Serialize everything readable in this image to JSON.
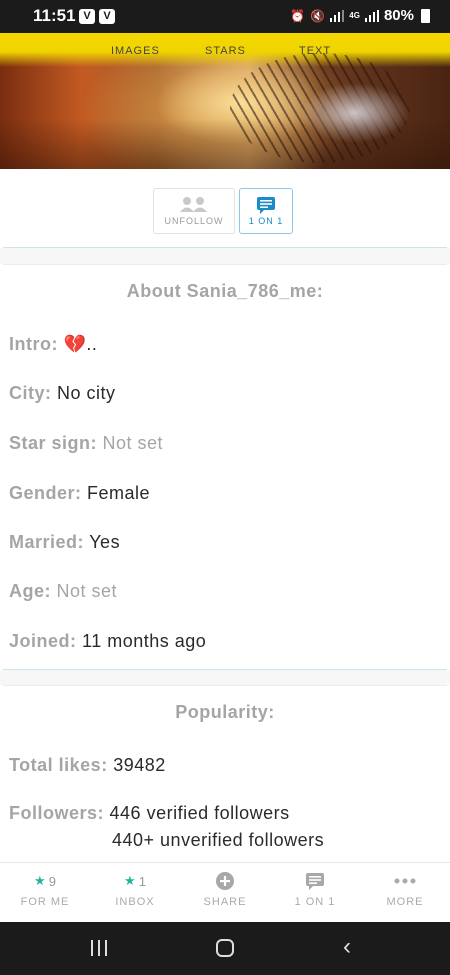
{
  "status_bar": {
    "time": "11:51",
    "app_icon_1": "V",
    "app_icon_2": "V",
    "battery": "80%",
    "network": "4G"
  },
  "header": {
    "tabs": [
      "IMAGES",
      "STARS",
      "TEXT"
    ]
  },
  "actions": {
    "unfollow_label": "UNFOLLOW",
    "one_on_one_label": "1 ON 1"
  },
  "about": {
    "title": "About Sania_786_me:",
    "fields": [
      {
        "label": "Intro:",
        "value": "..",
        "emoji": "💔"
      },
      {
        "label": "City:",
        "value": "No city"
      },
      {
        "label": "Star sign:",
        "value": "Not set"
      },
      {
        "label": "Gender:",
        "value": "Female"
      },
      {
        "label": "Married:",
        "value": "Yes"
      },
      {
        "label": "Age:",
        "value": "Not set"
      },
      {
        "label": "Joined:",
        "value": "11 months ago"
      }
    ]
  },
  "popularity": {
    "title": "Popularity:",
    "total_likes_label": "Total likes:",
    "total_likes_value": "39482",
    "followers_label": "Followers:",
    "followers_verified": "446 verified followers",
    "followers_unverified": "440+ unverified followers"
  },
  "bottom_nav": [
    {
      "count": "9",
      "label": "FOR ME",
      "icon": "star-icon"
    },
    {
      "count": "1",
      "label": "INBOX",
      "icon": "star-icon"
    },
    {
      "label": "SHARE",
      "icon": "plus-circle-icon"
    },
    {
      "label": "1 ON 1",
      "icon": "chat-icon"
    },
    {
      "label": "MORE",
      "icon": "more-dots-icon"
    }
  ],
  "colors": {
    "accent_blue": "#1a8bc8",
    "accent_teal": "#23b59a",
    "label_gray": "#a5a5a5",
    "header_yellow": "#f5d800"
  }
}
